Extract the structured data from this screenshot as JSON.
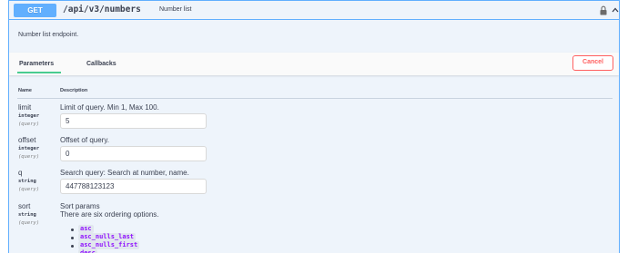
{
  "header": {
    "method": "GET",
    "path": "/api/v3/numbers",
    "summary": "Number list",
    "lock_icon": "lock-icon",
    "collapse_icon": "chevron-up-icon"
  },
  "description": "Number list endpoint.",
  "tabs": {
    "parameters": "Parameters",
    "callbacks": "Callbacks",
    "cancel": "Cancel"
  },
  "table": {
    "col_name": "Name",
    "col_description": "Description"
  },
  "params": [
    {
      "name": "limit",
      "type": "integer",
      "in": "(query)",
      "description": "Limit of query. Min 1, Max 100.",
      "value": "5"
    },
    {
      "name": "offset",
      "type": "integer",
      "in": "(query)",
      "description": "Offset of query.",
      "value": "0"
    },
    {
      "name": "q",
      "type": "string",
      "in": "(query)",
      "description": "Search query: Search at number, name.",
      "value": "447788123123"
    },
    {
      "name": "sort",
      "type": "string",
      "in": "(query)",
      "description": "Sort params",
      "description2": "There are six ordering options.",
      "options": [
        "asc",
        "asc_nulls_last",
        "asc_nulls_first",
        "desc"
      ]
    }
  ],
  "colors": {
    "get": "#61affe",
    "cancel": "#ff6060",
    "tab_active": "#49cc90",
    "code": "#9012fe"
  }
}
